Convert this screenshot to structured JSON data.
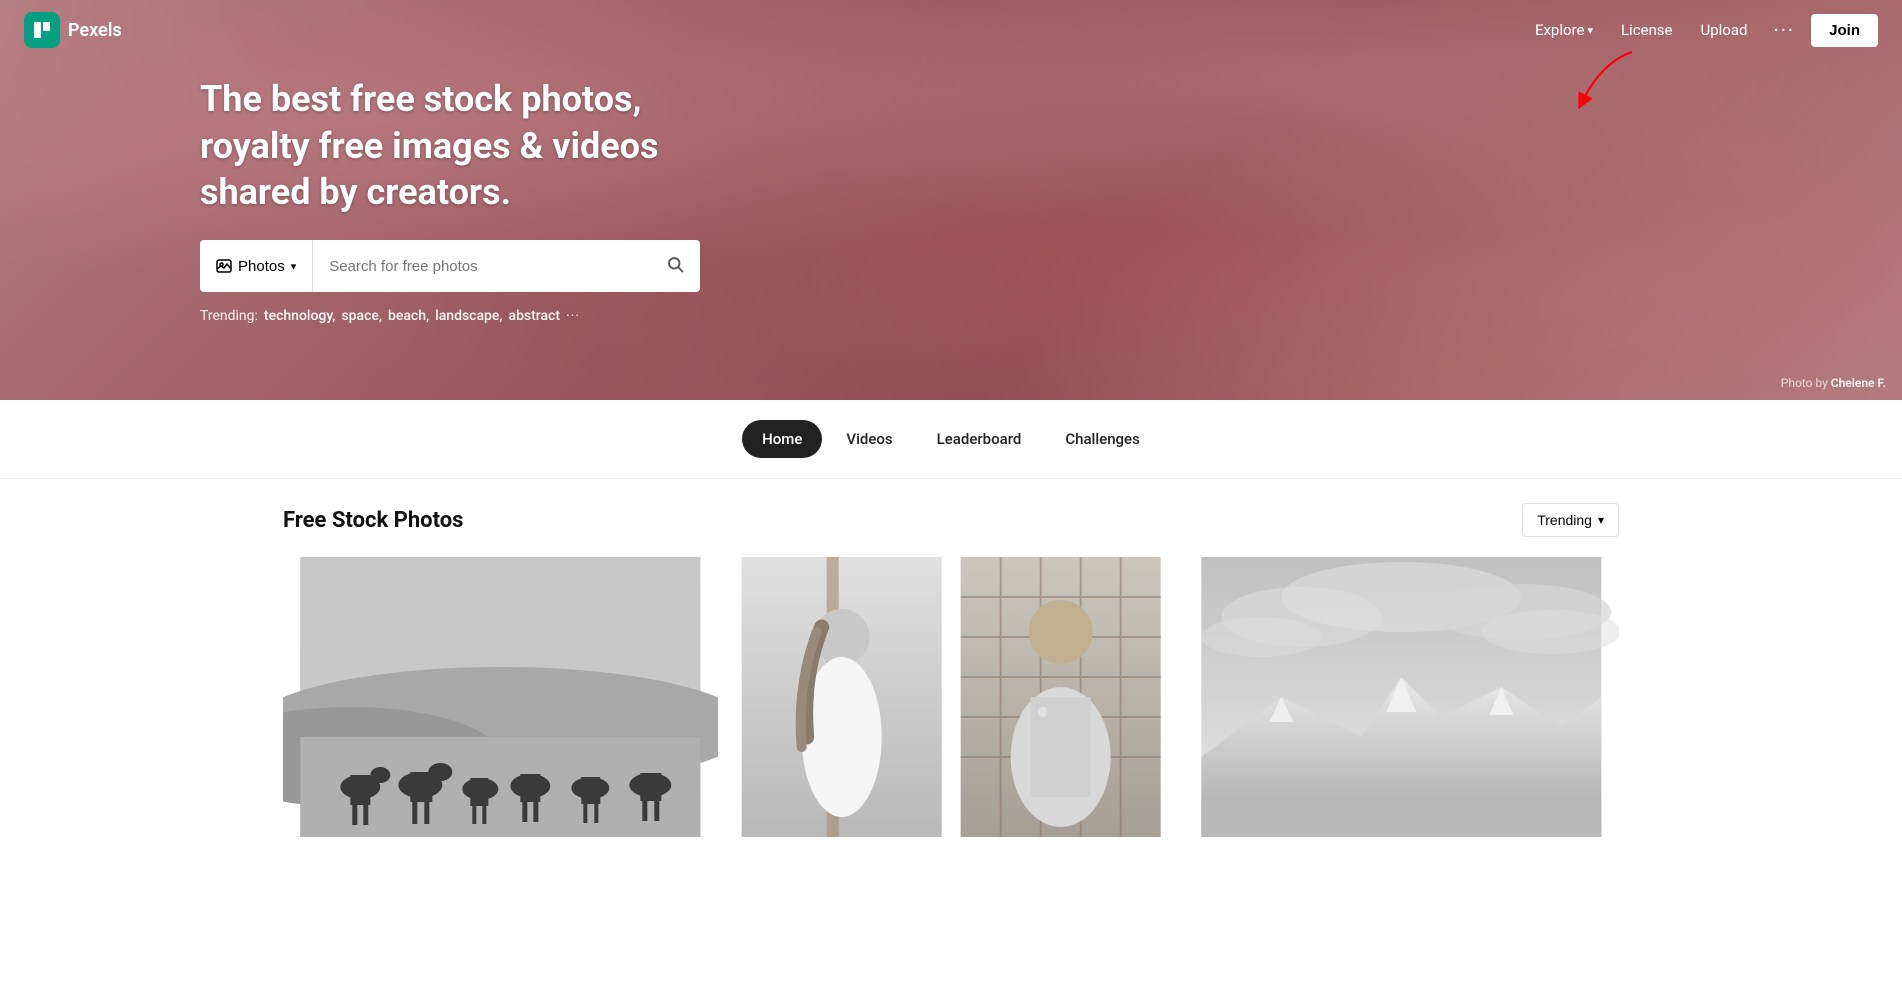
{
  "site": {
    "name": "Pexels",
    "logo_letter": "P"
  },
  "header": {
    "nav_links": [
      {
        "label": "Explore",
        "has_dropdown": true
      },
      {
        "label": "License",
        "has_dropdown": false
      },
      {
        "label": "Upload",
        "has_dropdown": false
      }
    ],
    "more_label": "···",
    "join_label": "Join"
  },
  "hero": {
    "title": "The best free stock photos, royalty free images & videos shared by creators.",
    "search_type": "Photos",
    "search_placeholder": "Search for free photos",
    "trending_label": "Trending:",
    "trending_items": [
      "technology",
      "space",
      "beach",
      "landscape",
      "abstract"
    ],
    "photo_credit_prefix": "Photo by",
    "photo_credit_name": "Chelene F."
  },
  "nav_tabs": [
    {
      "label": "Home",
      "active": true
    },
    {
      "label": "Videos",
      "active": false
    },
    {
      "label": "Leaderboard",
      "active": false
    },
    {
      "label": "Challenges",
      "active": false
    }
  ],
  "content": {
    "section_title": "Free Stock Photos",
    "sort_label": "Trending",
    "photos": [
      {
        "id": "horses",
        "alt": "Horses on a landscape",
        "type": "horses"
      },
      {
        "id": "wedding-couple",
        "alt": "Wedding couple",
        "type": "wedding"
      },
      {
        "id": "mountain",
        "alt": "Mountain landscape",
        "type": "mountain"
      }
    ]
  }
}
